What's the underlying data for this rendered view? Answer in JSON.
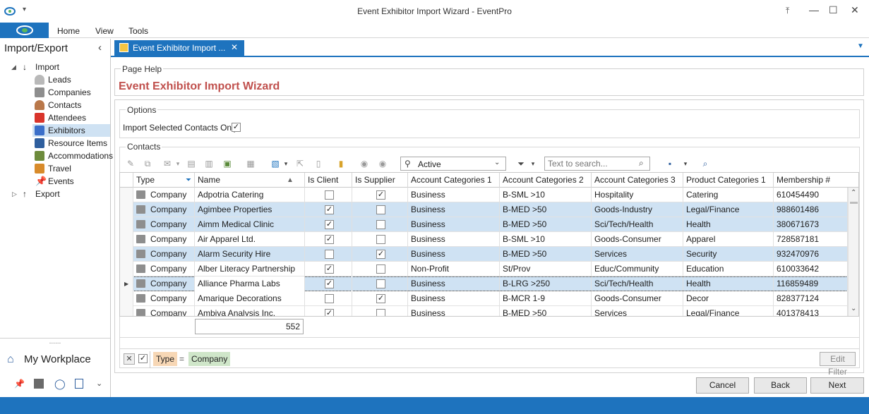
{
  "window": {
    "title": "Event Exhibitor Import Wizard - EventPro"
  },
  "ribbon": {
    "tabs": [
      "Home",
      "View",
      "Tools"
    ]
  },
  "sidebar": {
    "title": "Import/Export",
    "tree": [
      {
        "label": "Import",
        "level": 0
      },
      {
        "label": "Leads",
        "level": 1
      },
      {
        "label": "Companies",
        "level": 1
      },
      {
        "label": "Contacts",
        "level": 1
      },
      {
        "label": "Attendees",
        "level": 1
      },
      {
        "label": "Exhibitors",
        "level": 1,
        "selected": true
      },
      {
        "label": "Resource Items",
        "level": 1
      },
      {
        "label": "Accommodations",
        "level": 1
      },
      {
        "label": "Travel",
        "level": 1
      },
      {
        "label": "Events",
        "level": 1
      },
      {
        "label": "Export",
        "level": 0
      }
    ],
    "grip": "......",
    "workplace": "My Workplace"
  },
  "doc_tab": {
    "label": "Event Exhibitor Import ...",
    "close": "✕"
  },
  "page_help": {
    "label": "Page Help",
    "title": "Event Exhibitor Import Wizard"
  },
  "options": {
    "label": "Options",
    "checkbox_label": "Import Selected Contacts Only",
    "checked": true
  },
  "contacts": {
    "label": "Contacts",
    "filter_combo": "Active",
    "search_placeholder": "Text to search...",
    "columns": [
      "Type",
      "Name",
      "Is Client",
      "Is Supplier",
      "Account Categories 1",
      "Account Categories 2",
      "Account Categories 3",
      "Product Categories 1",
      "Membership #"
    ],
    "rows": [
      {
        "type": "Company",
        "name": "Adpotria Catering",
        "client": false,
        "supplier": true,
        "ac1": "Business",
        "ac2": "B-SML >10",
        "ac3": "Hospitality",
        "pc1": "Catering",
        "mem": "610454490",
        "sel": false
      },
      {
        "type": "Company",
        "name": "Agimbee Properties",
        "client": true,
        "supplier": false,
        "ac1": "Business",
        "ac2": "B-MED >50",
        "ac3": "Goods-Industry",
        "pc1": "Legal/Finance",
        "mem": "988601486",
        "sel": true
      },
      {
        "type": "Company",
        "name": "Aimm Medical Clinic",
        "client": true,
        "supplier": false,
        "ac1": "Business",
        "ac2": "B-MED >50",
        "ac3": "Sci/Tech/Health",
        "pc1": "Health",
        "mem": "380671673",
        "sel": true
      },
      {
        "type": "Company",
        "name": "Air Apparel Ltd.",
        "client": true,
        "supplier": false,
        "ac1": "Business",
        "ac2": "B-SML >10",
        "ac3": "Goods-Consumer",
        "pc1": "Apparel",
        "mem": "728587181",
        "sel": false
      },
      {
        "type": "Company",
        "name": "Alarm Security Hire",
        "client": false,
        "supplier": true,
        "ac1": "Business",
        "ac2": "B-MED >50",
        "ac3": "Services",
        "pc1": "Security",
        "mem": "932470976",
        "sel": true
      },
      {
        "type": "Company",
        "name": "Alber Literacy Partnership",
        "client": true,
        "supplier": false,
        "ac1": "Non-Profit",
        "ac2": "St/Prov",
        "ac3": "Educ/Community",
        "pc1": "Education",
        "mem": "610033642",
        "sel": false
      },
      {
        "type": "Company",
        "name": "Alliance Pharma Labs",
        "client": true,
        "supplier": false,
        "ac1": "Business",
        "ac2": "B-LRG >250",
        "ac3": "Sci/Tech/Health",
        "pc1": "Health",
        "mem": "116859489",
        "sel": true,
        "focused": true
      },
      {
        "type": "Company",
        "name": "Amarique Decorations",
        "client": false,
        "supplier": true,
        "ac1": "Business",
        "ac2": "B-MCR 1-9",
        "ac3": "Goods-Consumer",
        "pc1": "Decor",
        "mem": "828377124",
        "sel": false
      },
      {
        "type": "Company",
        "name": "Ambiva Analysis Inc.",
        "client": true,
        "supplier": false,
        "ac1": "Business",
        "ac2": "B-MED >50",
        "ac3": "Services",
        "pc1": "Legal/Finance",
        "mem": "401378413",
        "sel": false
      }
    ],
    "count": "552",
    "filter": {
      "field": "Type",
      "op": "=",
      "value": "Company",
      "edit_button": "Edit Filter"
    }
  },
  "footer": {
    "cancel": "Cancel",
    "back": "Back",
    "next": "Next"
  },
  "colors": {
    "accent": "#1e73be",
    "title_red": "#c0504d",
    "row_selected": "#cfe2f3",
    "filter_field": "#f7d7b5",
    "filter_value": "#cfe6c9"
  }
}
